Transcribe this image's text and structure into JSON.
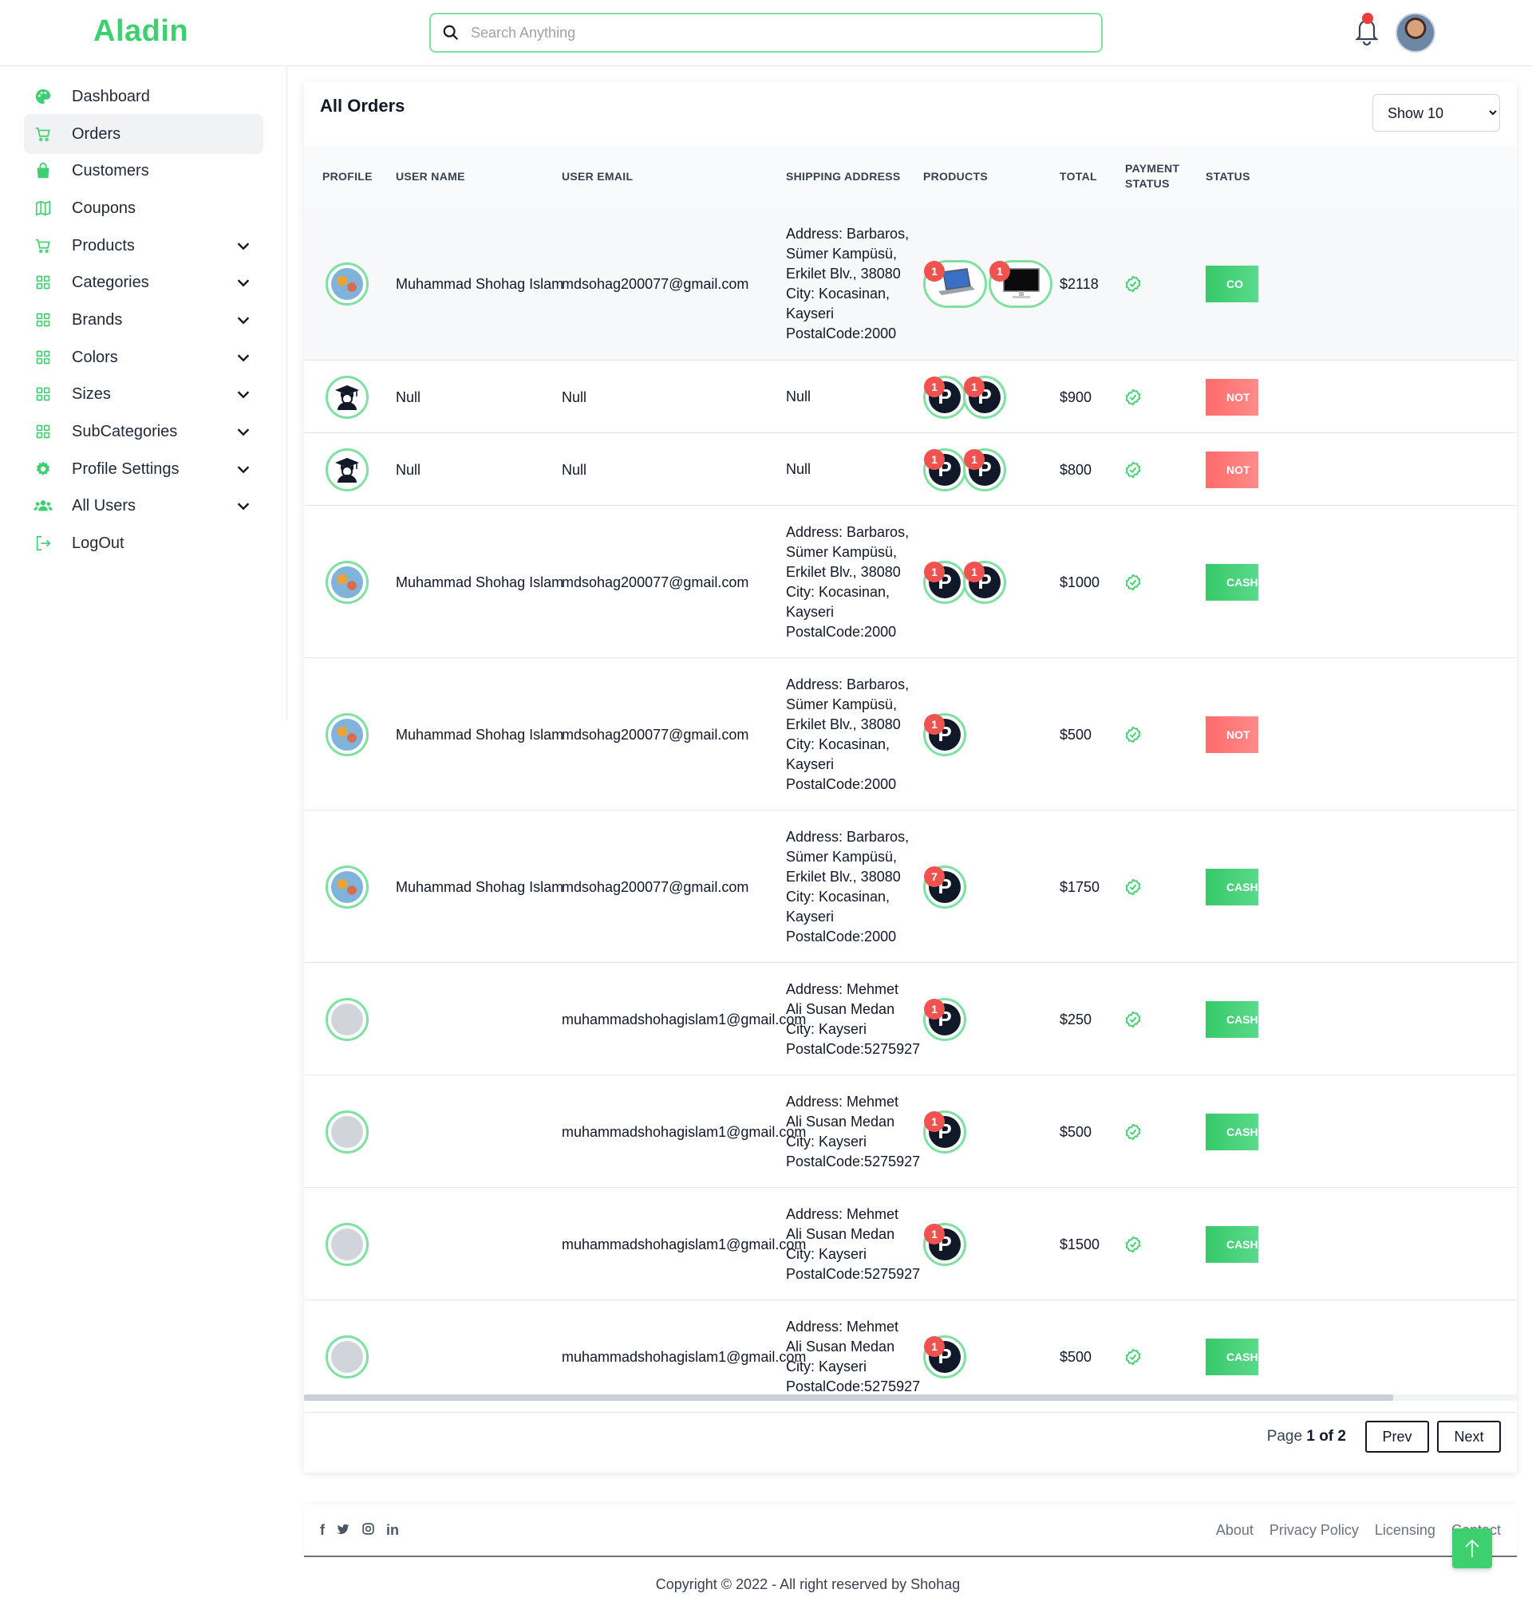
{
  "app": {
    "title": "Aladin"
  },
  "search": {
    "placeholder": "Search Anything"
  },
  "sidebar": {
    "items": [
      {
        "label": "Dashboard",
        "icon": "palette-icon",
        "expandable": false,
        "active": false
      },
      {
        "label": "Orders",
        "icon": "cart-icon",
        "expandable": false,
        "active": true
      },
      {
        "label": "Customers",
        "icon": "shopping-bag-icon",
        "expandable": false,
        "active": false
      },
      {
        "label": "Coupons",
        "icon": "map-icon",
        "expandable": false,
        "active": false
      },
      {
        "label": "Products",
        "icon": "cart-icon",
        "expandable": true,
        "active": false
      },
      {
        "label": "Categories",
        "icon": "grid-icon",
        "expandable": true,
        "active": false
      },
      {
        "label": "Brands",
        "icon": "grid-icon",
        "expandable": true,
        "active": false
      },
      {
        "label": "Colors",
        "icon": "grid-icon",
        "expandable": true,
        "active": false
      },
      {
        "label": "Sizes",
        "icon": "grid-icon",
        "expandable": true,
        "active": false
      },
      {
        "label": "SubCategories",
        "icon": "grid-icon",
        "expandable": true,
        "active": false
      },
      {
        "label": "Profile Settings",
        "icon": "gear-icon",
        "expandable": true,
        "active": false
      },
      {
        "label": "All Users",
        "icon": "users-icon",
        "expandable": true,
        "active": false
      },
      {
        "label": "LogOut",
        "icon": "logout-icon",
        "expandable": false,
        "active": false
      }
    ]
  },
  "orders": {
    "title": "All Orders",
    "show_select": "Show 10",
    "columns": {
      "profile": "PROFILE",
      "user_name": "USER NAME",
      "user_email": "USER EMAIL",
      "shipping_address": "SHIPPING ADDRESS",
      "products": "PRODUCTS",
      "total": "TOTAL",
      "payment_status_1": "PAYMENT",
      "payment_status_2": "STATUS",
      "status": "STATUS"
    },
    "rows": [
      {
        "avatar": "map",
        "name": "Muhammad Shohag Islam",
        "email": "mdsohag200077@gmail.com",
        "address": [
          "Address: Barbaros,",
          "Sümer Kampüsü,",
          "Erkilet Blv., 38080",
          "City: Kocasinan,",
          "Kayseri",
          "PostalCode:2000"
        ],
        "products": [
          {
            "kind": "laptop",
            "qty": "1"
          },
          {
            "kind": "monitor",
            "qty": "1"
          }
        ],
        "total": "$2118",
        "status": "CO",
        "status_color": "green"
      },
      {
        "avatar": "grad",
        "name": "Null",
        "email": "Null",
        "address": [
          "Null"
        ],
        "products": [
          {
            "kind": "p",
            "qty": "1"
          },
          {
            "kind": "p",
            "qty": "1"
          }
        ],
        "total": "$900",
        "status": "NOT",
        "status_color": "red"
      },
      {
        "avatar": "grad",
        "name": "Null",
        "email": "Null",
        "address": [
          "Null"
        ],
        "products": [
          {
            "kind": "p",
            "qty": "1"
          },
          {
            "kind": "p",
            "qty": "1"
          }
        ],
        "total": "$800",
        "status": "NOT",
        "status_color": "red"
      },
      {
        "avatar": "map",
        "name": "Muhammad Shohag Islam",
        "email": "mdsohag200077@gmail.com",
        "address": [
          "Address: Barbaros,",
          "Sümer Kampüsü,",
          "Erkilet Blv., 38080",
          "City: Kocasinan,",
          "Kayseri",
          "PostalCode:2000"
        ],
        "products": [
          {
            "kind": "p",
            "qty": "1"
          },
          {
            "kind": "p",
            "qty": "1"
          }
        ],
        "total": "$1000",
        "status": "CASH",
        "status_color": "green"
      },
      {
        "avatar": "map",
        "name": "Muhammad Shohag Islam",
        "email": "mdsohag200077@gmail.com",
        "address": [
          "Address: Barbaros,",
          "Sümer Kampüsü,",
          "Erkilet Blv., 38080",
          "City: Kocasinan,",
          "Kayseri",
          "PostalCode:2000"
        ],
        "products": [
          {
            "kind": "p",
            "qty": "1"
          }
        ],
        "total": "$500",
        "status": "NOT",
        "status_color": "red"
      },
      {
        "avatar": "map",
        "name": "Muhammad Shohag Islam",
        "email": "mdsohag200077@gmail.com",
        "address": [
          "Address: Barbaros,",
          "Sümer Kampüsü,",
          "Erkilet Blv., 38080",
          "City: Kocasinan,",
          "Kayseri",
          "PostalCode:2000"
        ],
        "products": [
          {
            "kind": "p",
            "qty": "7"
          }
        ],
        "total": "$1750",
        "status": "CASH",
        "status_color": "green"
      },
      {
        "avatar": "grey",
        "name": "",
        "email": "muhammadshohagislam1@gmail.com",
        "address": [
          "Address: Mehmet",
          "Ali Susan Medan",
          "City: Kayseri",
          "PostalCode:5275927"
        ],
        "products": [
          {
            "kind": "p",
            "qty": "1"
          }
        ],
        "total": "$250",
        "status": "CASH",
        "status_color": "green"
      },
      {
        "avatar": "grey",
        "name": "",
        "email": "muhammadshohagislam1@gmail.com",
        "address": [
          "Address: Mehmet",
          "Ali Susan Medan",
          "City: Kayseri",
          "PostalCode:5275927"
        ],
        "products": [
          {
            "kind": "p",
            "qty": "1"
          }
        ],
        "total": "$500",
        "status": "CASH",
        "status_color": "green"
      },
      {
        "avatar": "grey",
        "name": "",
        "email": "muhammadshohagislam1@gmail.com",
        "address": [
          "Address: Mehmet",
          "Ali Susan Medan",
          "City: Kayseri",
          "PostalCode:5275927"
        ],
        "products": [
          {
            "kind": "p",
            "qty": "1"
          }
        ],
        "total": "$1500",
        "status": "CASH",
        "status_color": "green"
      },
      {
        "avatar": "grey",
        "name": "",
        "email": "muhammadshohagislam1@gmail.com",
        "address": [
          "Address: Mehmet",
          "Ali Susan Medan",
          "City: Kayseri",
          "PostalCode:5275927"
        ],
        "products": [
          {
            "kind": "p",
            "qty": "1"
          }
        ],
        "total": "$500",
        "status": "CASH",
        "status_color": "green"
      }
    ],
    "pager": {
      "page_word": "Page",
      "current": "1",
      "of_word": "of",
      "total": "2",
      "prev": "Prev",
      "next": "Next"
    }
  },
  "footer": {
    "socials": [
      "facebook-icon",
      "twitter-icon",
      "instagram-icon",
      "linkedin-icon"
    ],
    "links": [
      "About",
      "Privacy Policy",
      "Licensing",
      "Contact"
    ],
    "copyright": "Copyright © 2022 - All right reserved by Shohag"
  },
  "colors": {
    "brand": "#3ecf6e",
    "danger": "#ef5350"
  }
}
